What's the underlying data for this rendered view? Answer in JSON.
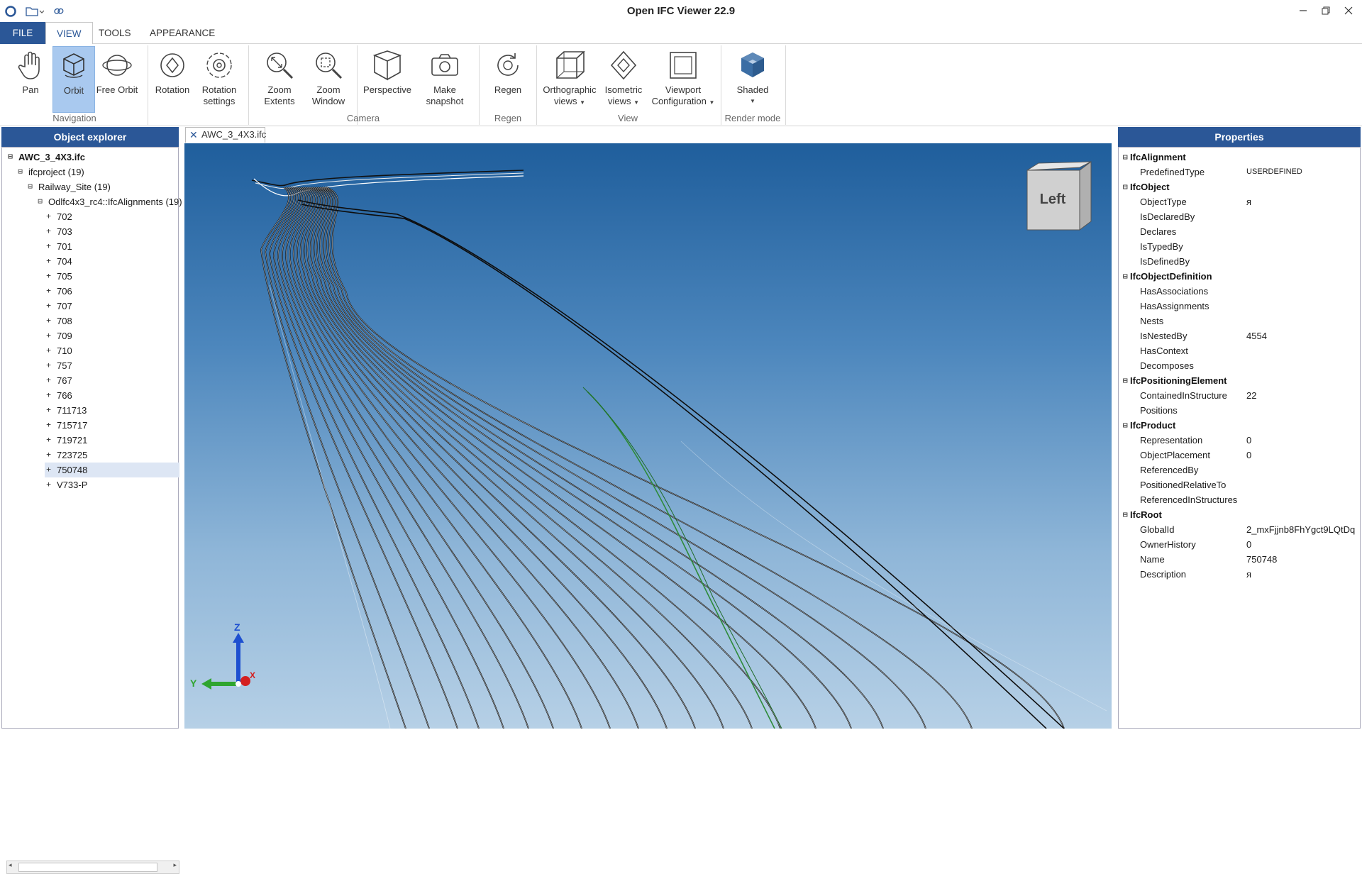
{
  "window": {
    "title": "Open IFC Viewer 22.9"
  },
  "ribbon": {
    "tabs": [
      "FILE",
      "VIEW",
      "TOOLS",
      "APPEARANCE"
    ],
    "active_tab": "VIEW",
    "buttons": {
      "pan": "Pan",
      "orbit": "Orbit",
      "free_orbit": "Free Orbit",
      "rotation": "Rotation",
      "rotation_settings_1": "Rotation",
      "rotation_settings_2": "settings",
      "zoom_extents_1": "Zoom",
      "zoom_extents_2": "Extents",
      "zoom_window_1": "Zoom",
      "zoom_window_2": "Window",
      "perspective": "Perspective",
      "snapshot_1": "Make",
      "snapshot_2": "snapshot",
      "regen": "Regen",
      "ortho_1": "Orthographic",
      "ortho_2": "views",
      "iso_1": "Isometric",
      "iso_2": "views",
      "viewport_1": "Viewport",
      "viewport_2": "Configuration",
      "shaded": "Shaded"
    },
    "groups": {
      "navigation": "Navigation",
      "camera": "Camera",
      "regen": "Regen",
      "view": "View",
      "render_mode": "Render mode"
    }
  },
  "explorer": {
    "title": "Object explorer",
    "root": "AWC_3_4X3.ifc",
    "project": "ifcproject (19)",
    "site": "Railway_Site (19)",
    "alignments": "Odlfc4x3_rc4::IfcAlignments (19)",
    "items": [
      "702",
      "703",
      "701",
      "704",
      "705",
      "706",
      "707",
      "708",
      "709",
      "710",
      "757",
      "767",
      "766",
      "711713",
      "715717",
      "719721",
      "723725",
      "750748",
      "V733-P"
    ],
    "selected": "750748"
  },
  "viewport": {
    "tab_label": "AWC_3_4X3.ifc",
    "viewcube_label": "Left",
    "axis_labels": {
      "z": "Z",
      "y": "Y",
      "x": "X"
    }
  },
  "properties": {
    "title": "Properties",
    "rows": [
      {
        "cat": "IfcAlignment"
      },
      {
        "name": "PredefinedType",
        "value": "USERDEFINED"
      },
      {
        "cat": "IfcObject"
      },
      {
        "name": "ObjectType",
        "value": "я"
      },
      {
        "name": "IsDeclaredBy",
        "value": ""
      },
      {
        "name": "Declares",
        "value": ""
      },
      {
        "name": "IsTypedBy",
        "value": ""
      },
      {
        "name": "IsDefinedBy",
        "value": ""
      },
      {
        "cat": "IfcObjectDefinition"
      },
      {
        "name": "HasAssociations",
        "value": ""
      },
      {
        "name": "HasAssignments",
        "value": ""
      },
      {
        "name": "Nests",
        "value": ""
      },
      {
        "name": "IsNestedBy",
        "value": "4554"
      },
      {
        "name": "HasContext",
        "value": ""
      },
      {
        "name": "Decomposes",
        "value": ""
      },
      {
        "cat": "IfcPositioningElement"
      },
      {
        "name": "ContainedInStructure",
        "value": "22"
      },
      {
        "name": "Positions",
        "value": ""
      },
      {
        "cat": "IfcProduct"
      },
      {
        "name": "Representation",
        "value": "0"
      },
      {
        "name": "ObjectPlacement",
        "value": "0"
      },
      {
        "name": "ReferencedBy",
        "value": ""
      },
      {
        "name": "PositionedRelativeTo",
        "value": ""
      },
      {
        "name": "ReferencedInStructures",
        "value": ""
      },
      {
        "cat": "IfcRoot"
      },
      {
        "name": "GlobalId",
        "value": "2_mxFjjnb8FhYgct9LQtDq"
      },
      {
        "name": "OwnerHistory",
        "value": "0"
      },
      {
        "name": "Name",
        "value": "750748"
      },
      {
        "name": "Description",
        "value": "я"
      }
    ]
  },
  "colors": {
    "accent": "#2b5797",
    "selection": "#a9c9ef",
    "highlight_track": "#2e8b3a"
  }
}
